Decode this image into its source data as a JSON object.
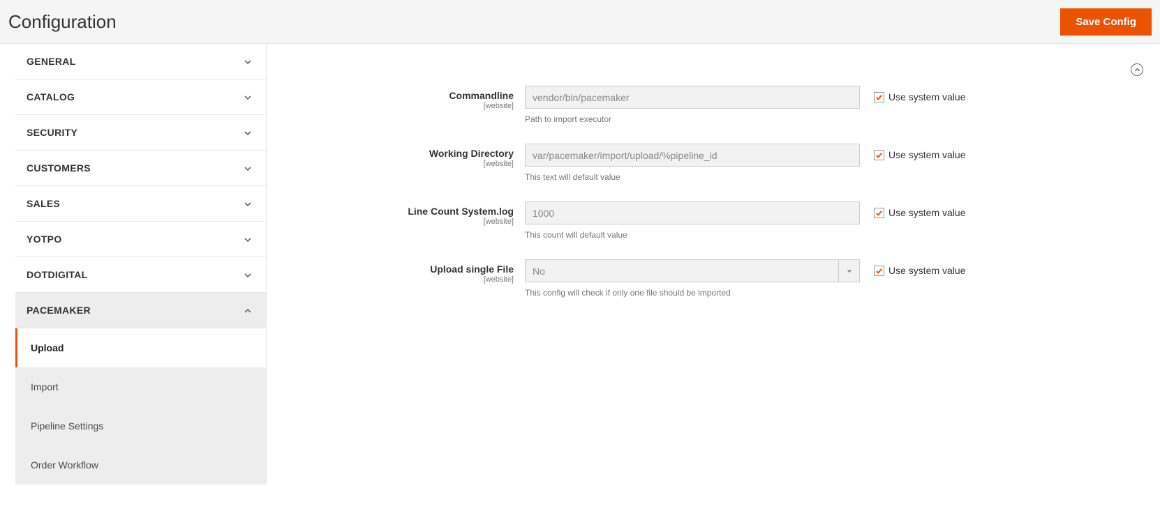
{
  "header": {
    "title": "Configuration",
    "save_label": "Save Config"
  },
  "sidebar": {
    "items": [
      {
        "label": "GENERAL",
        "expanded": false
      },
      {
        "label": "CATALOG",
        "expanded": false
      },
      {
        "label": "SECURITY",
        "expanded": false
      },
      {
        "label": "CUSTOMERS",
        "expanded": false
      },
      {
        "label": "SALES",
        "expanded": false
      },
      {
        "label": "YOTPO",
        "expanded": false
      },
      {
        "label": "DOTDIGITAL",
        "expanded": false
      },
      {
        "label": "PACEMAKER",
        "expanded": true
      }
    ],
    "subitems": [
      {
        "label": "Upload",
        "active": true
      },
      {
        "label": "Import",
        "active": false
      },
      {
        "label": "Pipeline Settings",
        "active": false
      },
      {
        "label": "Order Workflow",
        "active": false
      }
    ]
  },
  "form": {
    "scope_label": "[website]",
    "use_system_label": "Use system value",
    "fields": {
      "commandline": {
        "label": "Commandline",
        "value": "vendor/bin/pacemaker",
        "help": "Path to import executor",
        "use_system": true
      },
      "working_dir": {
        "label": "Working Directory",
        "value": "var/pacemaker/import/upload/%pipeline_id",
        "help": "This text will default value",
        "use_system": true
      },
      "line_count": {
        "label": "Line Count System.log",
        "value": "1000",
        "help": "This count will default value",
        "use_system": true
      },
      "upload_single": {
        "label": "Upload single File",
        "value": "No",
        "help": "This config will check if only one file should be imported",
        "use_system": true
      }
    }
  }
}
